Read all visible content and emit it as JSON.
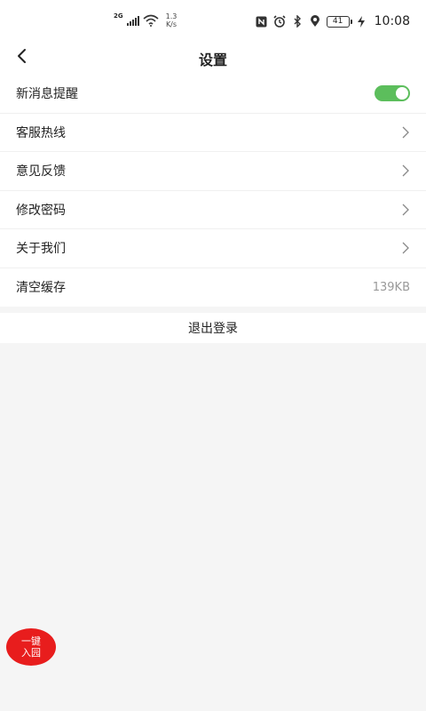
{
  "status_bar": {
    "network": "2G",
    "speed_value": "1.3",
    "speed_unit": "K/s",
    "battery": "41",
    "time": "10:08"
  },
  "header": {
    "title": "设置"
  },
  "settings": {
    "items": [
      {
        "label": "新消息提醒",
        "type": "toggle",
        "enabled": true
      },
      {
        "label": "客服热线",
        "type": "link"
      },
      {
        "label": "意见反馈",
        "type": "link"
      },
      {
        "label": "修改密码",
        "type": "link"
      },
      {
        "label": "关于我们",
        "type": "link"
      },
      {
        "label": "清空缓存",
        "type": "value",
        "value": "139KB"
      }
    ]
  },
  "logout": {
    "label": "退出登录"
  },
  "fab": {
    "line1": "一键",
    "line2": "入园"
  },
  "colors": {
    "toggle_on": "#5cbe5c",
    "fab": "#e81d1d",
    "background": "#f5f5f5"
  }
}
